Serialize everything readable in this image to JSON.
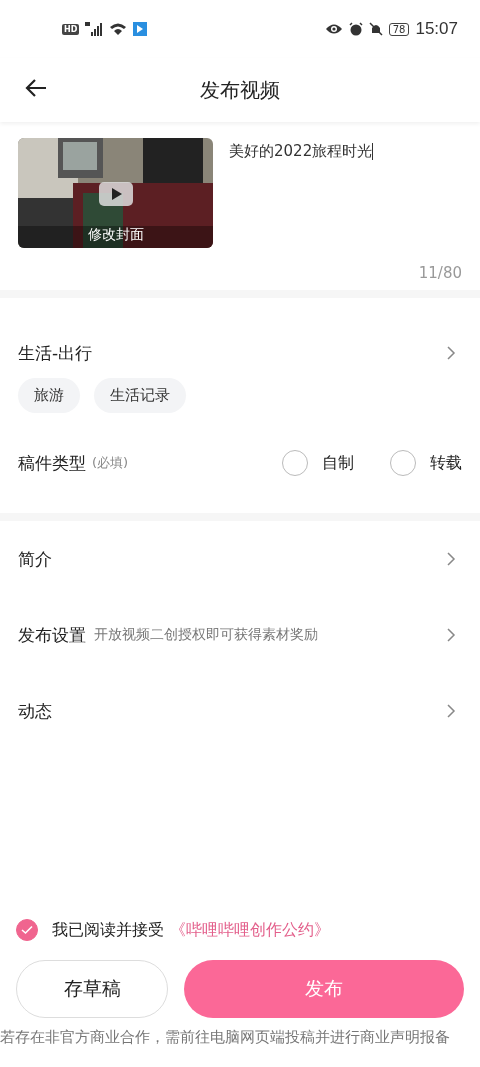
{
  "status_bar": {
    "network": "HD",
    "time": "15:07",
    "battery": "78"
  },
  "header": {
    "title": "发布视频"
  },
  "cover": {
    "kind": "picture",
    "label": "修改封面"
  },
  "title_field": {
    "value": "美好的2022旅程时光",
    "counter": "11/80"
  },
  "category": {
    "label": "生活-出行"
  },
  "tags": [
    {
      "label": "旅游"
    },
    {
      "label": "生活记录"
    }
  ],
  "type": {
    "label": "稿件类型",
    "hint": "(必填)",
    "options": [
      {
        "label": "自制",
        "selected": false
      },
      {
        "label": "转载",
        "selected": false
      }
    ]
  },
  "rows": [
    {
      "label": "简介"
    },
    {
      "label": "发布设置",
      "hint": "开放视频二创授权即可获得素材奖励"
    },
    {
      "label": "动态"
    }
  ],
  "agreement": {
    "checked": true,
    "text": "我已阅读并接受",
    "link": "《哔哩哔哩创作公约》"
  },
  "buttons": {
    "draft": "存草稿",
    "publish": "发布"
  },
  "footer": "若存在非官方商业合作，需前往电脑网页端投稿并进行商业声明报备"
}
